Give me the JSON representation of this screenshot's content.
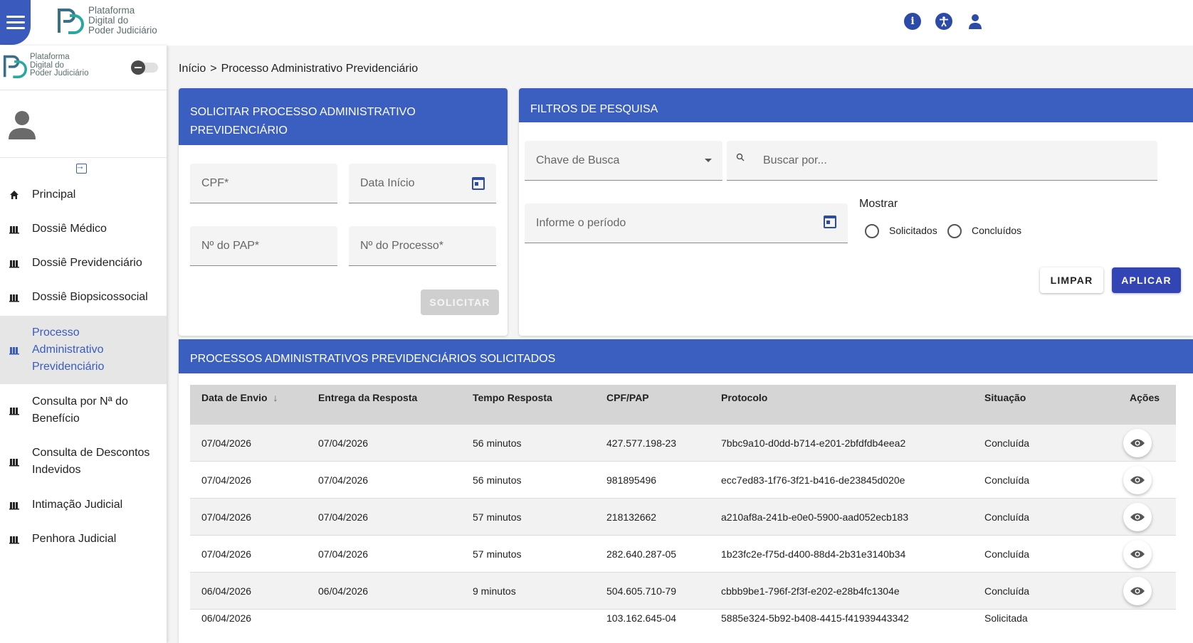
{
  "header": {
    "logo_lines": [
      "Plataforma",
      "Digital do",
      "Poder Judiciário"
    ],
    "icons": [
      "info-icon",
      "accessibility-icon",
      "user-icon"
    ]
  },
  "sidebar": {
    "logo_lines": [
      "Plataforma",
      "Digital do",
      "Poder Judiciário"
    ],
    "items": [
      {
        "label": "Principal",
        "icon": "home-icon"
      },
      {
        "label": "Dossiê Médico",
        "icon": "books-icon"
      },
      {
        "label": "Dossiê Previdenciário",
        "icon": "books-icon"
      },
      {
        "label": "Dossiê Biopsicossocial",
        "icon": "books-icon"
      },
      {
        "label_lines": [
          "Processo",
          "Administrativo",
          "Previdenciário"
        ],
        "icon": "books-icon",
        "active": true
      },
      {
        "label_lines": [
          "Consulta por Nª do",
          "Benefício"
        ],
        "icon": "books-icon"
      },
      {
        "label_lines": [
          "Consulta de Descontos",
          "Indevidos"
        ],
        "icon": "books-icon"
      },
      {
        "label": "Intimação Judicial",
        "icon": "books-icon"
      },
      {
        "label": "Penhora Judicial",
        "icon": "books-icon"
      }
    ]
  },
  "breadcrumb": {
    "home": "Início",
    "separator": ">",
    "current": "Processo Administrativo Previdenciário"
  },
  "request_panel": {
    "title_lines": [
      "SOLICITAR PROCESSO ADMINISTRATIVO",
      "PREVIDENCIÁRIO"
    ],
    "cpf_placeholder": "CPF*",
    "start_date_placeholder": "Data Início",
    "pap_placeholder": "Nº do PAP*",
    "process_placeholder": "Nº do Processo*",
    "submit_label": "SOLICITAR"
  },
  "filters_panel": {
    "title": "FILTROS DE PESQUISA",
    "search_key_placeholder": "Chave de Busca",
    "search_placeholder": "Buscar por...",
    "period_placeholder": "Informe o período",
    "show_label": "Mostrar",
    "radio_requested": "Solicitados",
    "radio_completed": "Concluídos",
    "clear_label": "LIMPAR",
    "apply_label": "APLICAR"
  },
  "results_panel": {
    "title": "PROCESSOS ADMINISTRATIVOS PREVIDENCIÁRIOS SOLICITADOS",
    "columns": [
      "Data de Envio",
      "Entrega da Resposta",
      "Tempo Resposta",
      "CPF/PAP",
      "Protocolo",
      "Situação",
      "Ações"
    ],
    "sort_indicator": "↓",
    "rows": [
      {
        "sent": "07/04/2026",
        "delivered": "07/04/2026",
        "time": "56 minutos",
        "cpf": "427.577.198-23",
        "protocol": "7bbc9a10-d0dd-b714-e201-2bfdfdb4eea2",
        "status": "Concluída"
      },
      {
        "sent": "07/04/2026",
        "delivered": "07/04/2026",
        "time": "56 minutos",
        "cpf": "981895496",
        "protocol": "ecc7ed83-1f76-3f21-b416-de23845d020e",
        "status": "Concluída"
      },
      {
        "sent": "07/04/2026",
        "delivered": "07/04/2026",
        "time": "57 minutos",
        "cpf": "218132662",
        "protocol": "a210af8a-241b-e0e0-5900-aad052ecb183",
        "status": "Concluída"
      },
      {
        "sent": "07/04/2026",
        "delivered": "07/04/2026",
        "time": "57 minutos",
        "cpf": "282.640.287-05",
        "protocol": "1b23fc2e-f75d-d400-88d4-2b31e3140b34",
        "status": "Concluída"
      },
      {
        "sent": "06/04/2026",
        "delivered": "06/04/2026",
        "time": "9 minutos",
        "cpf": "504.605.710-79",
        "protocol": "cbbb9be1-796f-2f3f-e202-e28b4fc1304e",
        "status": "Concluída"
      },
      {
        "sent": "06/04/2026",
        "delivered": "",
        "time": "",
        "cpf": "103.162.645-04",
        "protocol": "5885e324-5b92-b408-4415-f41939443342",
        "status": "Solicitada"
      }
    ]
  },
  "colors": {
    "primary": "#3a5fc0",
    "primary_dark": "#2c4aa8",
    "apply_button": "#3344b5"
  }
}
